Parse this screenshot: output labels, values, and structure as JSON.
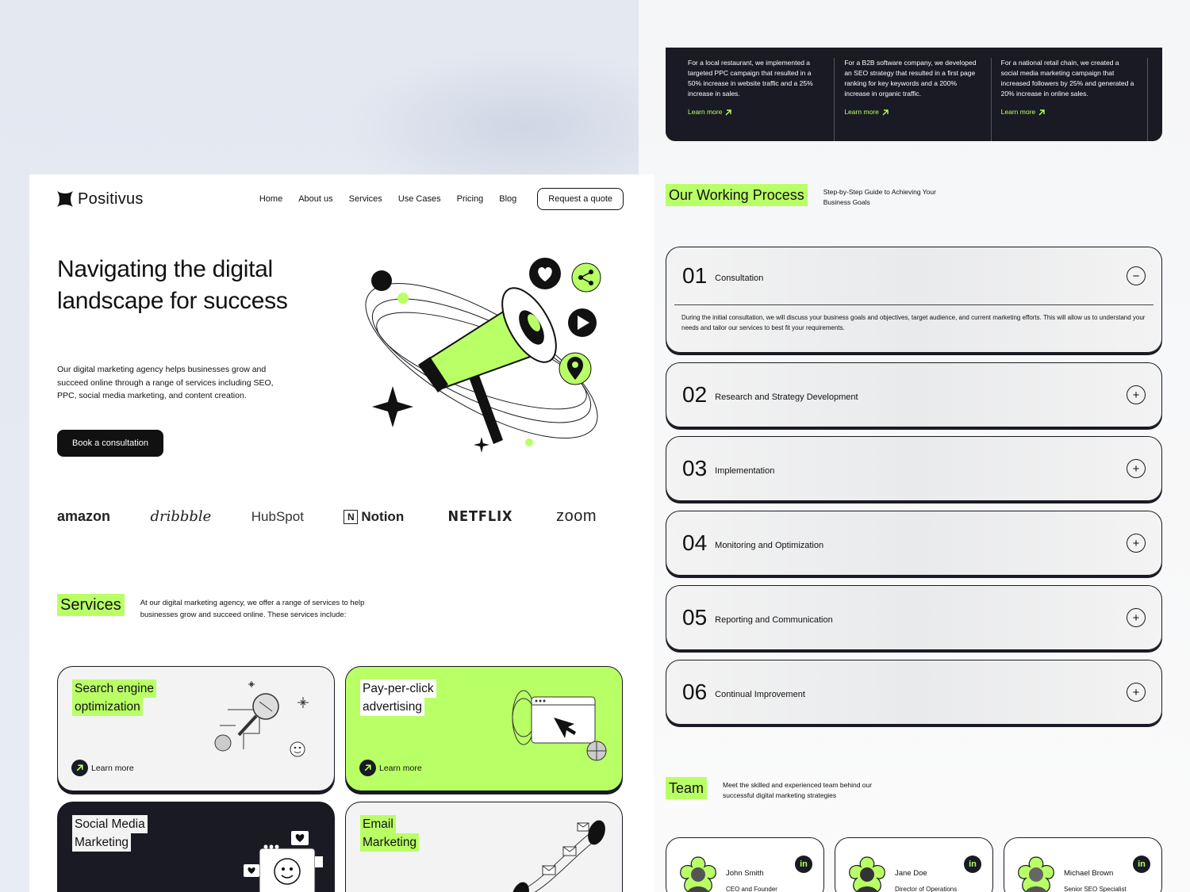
{
  "nav": {
    "brand": "Positivus",
    "links": [
      "Home",
      "About us",
      "Services",
      "Use Cases",
      "Pricing",
      "Blog"
    ],
    "cta": "Request a quote"
  },
  "hero": {
    "title": "Navigating the digital landscape for success",
    "text": "Our digital marketing agency helps businesses grow and succeed online through a range of services including SEO, PPC, social media marketing, and content creation.",
    "button": "Book a consultation"
  },
  "brands": [
    "amazon",
    "dribbble",
    "HubSpot",
    "Notion",
    "NETFLIX",
    "zoom"
  ],
  "services": {
    "tag": "Services",
    "desc": "At our digital marketing agency, we offer a range of services to help businesses grow and succeed online. These services include:",
    "learn_more": "Learn more",
    "cards": [
      {
        "title_line1": "Search engine",
        "title_line2": "optimization"
      },
      {
        "title_line1": "Pay-per-click",
        "title_line2": "advertising"
      },
      {
        "title_line1": "Social Media",
        "title_line2": "Marketing"
      },
      {
        "title_line1": "Email",
        "title_line2": "Marketing"
      }
    ]
  },
  "cases": [
    {
      "text": "For a local restaurant, we implemented a targeted PPC campaign that resulted in a 50% increase in website traffic and a 25% increase in sales.",
      "more": "Learn more"
    },
    {
      "text": "For a B2B software company, we developed an SEO strategy that resulted in a first page ranking for key keywords and a 200% increase in organic traffic.",
      "more": "Learn more"
    },
    {
      "text": "For a national retail chain, we created a social media marketing campaign that increased followers by 25% and generated a 20% increase in online sales.",
      "more": "Learn more"
    }
  ],
  "process": {
    "tag": "Our Working Process",
    "desc": "Step-by-Step Guide to Achieving Your Business Goals",
    "steps": [
      {
        "num": "01",
        "title": "Consultation",
        "toggle": "−",
        "body": "During the initial consultation, we will discuss your business goals and objectives, target audience, and current marketing efforts. This will allow us to understand your needs and tailor our services to best fit your requirements."
      },
      {
        "num": "02",
        "title": "Research and Strategy Development",
        "toggle": "+"
      },
      {
        "num": "03",
        "title": "Implementation",
        "toggle": "+"
      },
      {
        "num": "04",
        "title": "Monitoring and Optimization",
        "toggle": "+"
      },
      {
        "num": "05",
        "title": "Reporting and Communication",
        "toggle": "+"
      },
      {
        "num": "06",
        "title": "Continual Improvement",
        "toggle": "+"
      }
    ]
  },
  "team": {
    "tag": "Team",
    "desc": "Meet the skilled and experienced team behind our successful digital marketing strategies",
    "linkedin": "in",
    "members": [
      {
        "name": "John Smith",
        "role": "CEO and Founder"
      },
      {
        "name": "Jane Doe",
        "role": "Director of Operations"
      },
      {
        "name": "Michael Brown",
        "role": "Senior SEO Specialist"
      }
    ]
  },
  "colors": {
    "accent": "#b9ff66",
    "dark": "#191a23",
    "card_grey": "#f3f3f3"
  }
}
